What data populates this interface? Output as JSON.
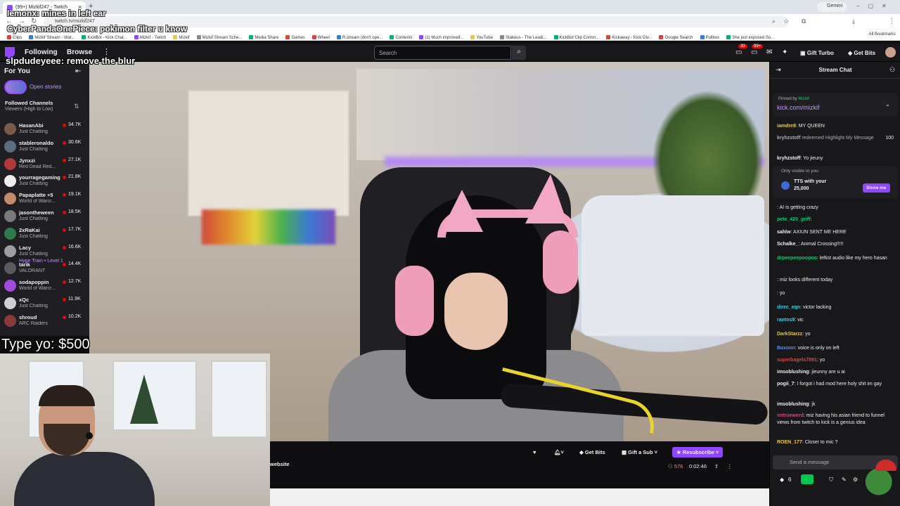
{
  "browser": {
    "tab_title": "(99+) Mizkif247 - Twitch",
    "url": "twitch.tv/mizkif247",
    "gemini_label": "Gemini",
    "bookmarks": [
      "Clips",
      "Mizkif Stream - Wat...",
      "KickBot - Kick Chat...",
      "Mizkif - Twitch",
      "Mizkif",
      "Mizkif Stream Sche...",
      "Media Share",
      "Games",
      "Wheel",
      "R.stream (don't ope...",
      "Contexto",
      "(1) Much improved...",
      "YouTube",
      "Stakeus - The Leadi...",
      "KickBot Clip Comm...",
      "Kickaway - Kick Giv...",
      "Google Search",
      "Pullbox",
      "She just exposed So..."
    ],
    "all_bookmarks": "All Bookmarks"
  },
  "topnav": {
    "following": "Following",
    "browse": "Browse",
    "search_placeholder": "Search",
    "notif_count_1": "30",
    "notif_count_2": "99+",
    "gift_turbo": "Gift Turbo",
    "get_bits": "Get Bits"
  },
  "overlays": {
    "line1": "lemonx: mines in left ear",
    "line2": "CyberPandaOnePiece: pokimon filter u know",
    "line3": "slpdudeyeee: remove the blur",
    "type_yo": "Type yo: $500"
  },
  "sidebar": {
    "for_you": "For You",
    "open_stories": "Open stories",
    "followed_channels": "Followed Channels",
    "sort": "Viewers (High to Low)",
    "channels": [
      {
        "name": "HasanAbi",
        "game": "Just Chatting",
        "viewers": "34.7K",
        "color": "#7a5a48"
      },
      {
        "name": "stableronaldo",
        "game": "Just Chatting",
        "viewers": "30.6K",
        "color": "#5a6e7e"
      },
      {
        "name": "Jynxzi",
        "game": "Red Dead Red...",
        "viewers": "27.1K",
        "color": "#b03a3a"
      },
      {
        "name": "yourragegaming",
        "game": "Just Chatting",
        "viewers": "21.8K",
        "color": "#eeeeee"
      },
      {
        "name": "Papaplatte +5",
        "game": "World of Warcr...",
        "viewers": "19.1K",
        "color": "#c48a6a"
      },
      {
        "name": "jasontheween",
        "game": "Just Chatting",
        "viewers": "18.5K",
        "color": "#7a7a7a"
      },
      {
        "name": "2xRaKai",
        "game": "Just Chatting",
        "viewers": "17.7K",
        "color": "#2f7a4a"
      },
      {
        "name": "Lacy",
        "game": "Just Chatting",
        "viewers": "16.6K",
        "color": "#9e9e9e",
        "extra": "Hype Train • Level 1"
      },
      {
        "name": "tarik",
        "game": "VALORANT",
        "viewers": "14.4K",
        "color": "#5a5a5a"
      },
      {
        "name": "sodapoppin",
        "game": "World of Warcr...",
        "viewers": "12.7K",
        "color": "#a04ae0"
      },
      {
        "name": "xQc",
        "game": "Just Chatting",
        "viewers": "11.9K",
        "color": "#cfcfcf"
      },
      {
        "name": "shroud",
        "game": "ARC Raiders",
        "viewers": "10.2K",
        "color": "#8a3a3a"
      }
    ]
  },
  "player": {
    "website_label": "website",
    "get_bits": "Get Bits",
    "gift_sub": "Gift a Sub",
    "resubscribe": "Resubscribe",
    "viewers": "576",
    "uptime": "0:02:46"
  },
  "chat": {
    "title": "Stream Chat",
    "pinned_by": "Pinned by",
    "pinned_user": "Mizkif",
    "pinned_link": "kick.com/mizkif",
    "only_visible": "Only visible to you",
    "tts_title": "TTS with your",
    "tts_amount": "25,000",
    "show_me": "Show me",
    "input_placeholder": "Send a message",
    "bits_count": "6",
    "messages": [
      {
        "user": "iamdre8",
        "color": "#e6c84a",
        "text": "MY QUEEN"
      },
      {
        "user": "kryhzstoff",
        "color": "#adadb8",
        "text": "redeemed Highlight My Message",
        "extra": "100"
      },
      {
        "user": "kryhzstoff",
        "color": "#efeff1",
        "text": "Yo jieuny"
      },
      {
        "user": "",
        "color": "#d6447a",
        "text": "AI is getting crazy"
      },
      {
        "user": "pete_420_griff",
        "color": "#00d26a",
        "text": ""
      },
      {
        "user": "sahlw",
        "color": "#efeff1",
        "text": "AXIUN SENT ME HERE"
      },
      {
        "user": "Schalke_",
        "color": "#efeff1",
        "text": "Animal Crossing!!!!!"
      },
      {
        "user": "drpeepeepoopoo",
        "color": "#00d26a",
        "text": "leftist audio like my hero hasan"
      },
      {
        "user": "",
        "color": "#d6447a",
        "text": "miz looks different today"
      },
      {
        "user": "",
        "color": "#d6447a",
        "text": "yo"
      },
      {
        "user": "direc_eqn",
        "color": "#2fd4f0",
        "text": "victor lacking"
      },
      {
        "user": "rantos9",
        "color": "#2fd4f0",
        "text": "vic"
      },
      {
        "user": "DarkStarzz",
        "color": "#e6c84a",
        "text": "yo"
      },
      {
        "user": "Baxoon",
        "color": "#5a8af0",
        "text": "voice is only on left"
      },
      {
        "user": "superbagels7891",
        "color": "#e04040",
        "text": "yo"
      },
      {
        "user": "imsoblushing",
        "color": "#efeff1",
        "text": "jieunny are u ai"
      },
      {
        "user": "pogii_7",
        "color": "#efeff1",
        "text": "I forgot i had mod here holy shit im gay"
      },
      {
        "user": "imsoblushing",
        "color": "#efeff1",
        "text": "jk"
      },
      {
        "user": "imtruewerd",
        "color": "#d6447a",
        "text": "miz having his asian friend to funnel views from twitch to kick is a genius idea"
      },
      {
        "user": "ROEN_177",
        "color": "#e6c84a",
        "text": "Closer to mic ?"
      }
    ]
  }
}
